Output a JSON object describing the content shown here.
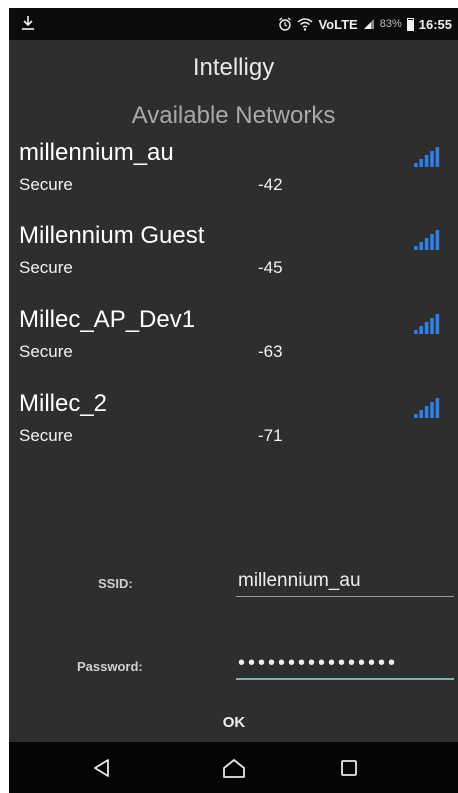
{
  "status_bar": {
    "icons": [
      "download-icon",
      "alarm-icon",
      "wifi-calling-icon",
      "volte-icon",
      "cell-signal-icon",
      "battery-icon"
    ],
    "volte_label": "VoLTE",
    "battery_percent": "83%",
    "battery_level": 0.83,
    "time": "16:55"
  },
  "app": {
    "title": "Intelligy"
  },
  "networks": {
    "heading": "Available Networks",
    "signal_color": "#2f7fe6",
    "items": [
      {
        "ssid": "millennium_au",
        "security": "Secure",
        "rssi": "-42",
        "signal_bars": 5
      },
      {
        "ssid": "Millennium Guest",
        "security": "Secure",
        "rssi": "-45",
        "signal_bars": 5
      },
      {
        "ssid": "Millec_AP_Dev1",
        "security": "Secure",
        "rssi": "-63",
        "signal_bars": 5
      },
      {
        "ssid": "Millec_2",
        "security": "Secure",
        "rssi": "-71",
        "signal_bars": 5
      }
    ]
  },
  "form": {
    "ssid_label": "SSID:",
    "ssid_value": "millennium_au",
    "password_label": "Password:",
    "password_value": "••••••••••••••••",
    "ok_label": "OK",
    "accent_color": "#76b7b2"
  },
  "nav_bar": {
    "icons": [
      "back-icon",
      "home-icon",
      "recents-icon"
    ]
  }
}
